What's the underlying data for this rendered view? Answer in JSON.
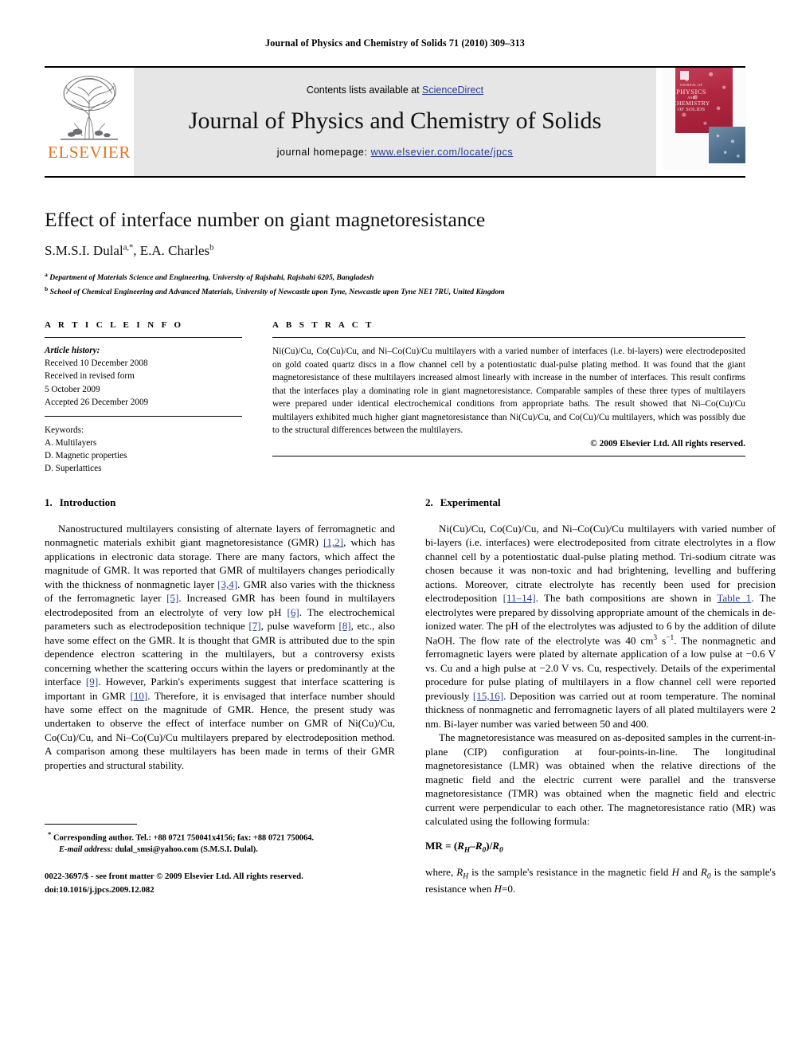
{
  "running_head": "Journal of Physics and Chemistry of Solids 71 (2010) 309–313",
  "masthead": {
    "publisher_name": "ELSEVIER",
    "contents_prefix": "Contents lists available at ",
    "contents_link": "ScienceDirect",
    "journal_title": "Journal of Physics and Chemistry of Solids",
    "homepage_prefix": "journal homepage: ",
    "homepage_url": "www.elsevier.com/locate/jpcs",
    "cover": {
      "line1": "JOURNAL OF",
      "line2": "PHYSICS",
      "line3": "AND",
      "line4": "CHEMISTRY",
      "line5": "OF SOLIDS"
    }
  },
  "article": {
    "title": "Effect of interface number on giant magnetoresistance",
    "authors": "S.M.S.I. Dulal",
    "author1_sup": "a,*",
    "author2": "E.A. Charles",
    "author2_sup": "b",
    "affiliation_a_marker": "a",
    "affiliation_a": "Department of Materials Science and Engineering, University of Rajshahi, Rajshahi 6205, Bangladesh",
    "affiliation_b_marker": "b",
    "affiliation_b": "School of Chemical Engineering and Advanced Materials, University of Newcastle upon Tyne, Newcastle upon Tyne NE1 7RU, United Kingdom"
  },
  "article_info": {
    "heading": "A R T I C L E   I N F O",
    "history_label": "Article history:",
    "history": [
      "Received 10 December 2008",
      "Received in revised form",
      "5 October 2009",
      "Accepted 26 December 2009"
    ],
    "keywords_label": "Keywords:",
    "keywords": [
      "A. Multilayers",
      "D. Magnetic properties",
      "D. Superlattices"
    ]
  },
  "abstract": {
    "heading": "A B S T R A C T",
    "text": "Ni(Cu)/Cu, Co(Cu)/Cu, and Ni–Co(Cu)/Cu multilayers with a varied number of interfaces (i.e. bi-layers) were electrodeposited on gold coated quartz discs in a flow channel cell by a potentiostatic dual-pulse plating method. It was found that the giant magnetoresistance of these multilayers increased almost linearly with increase in the number of interfaces. This result confirms that the interfaces play a dominating role in giant magnetoresistance. Comparable samples of these three types of multilayers were prepared under identical electrochemical conditions from appropriate baths. The result showed that Ni–Co(Cu)/Cu multilayers exhibited much higher giant magnetoresistance than Ni(Cu)/Cu, and Co(Cu)/Cu multilayers, which was possibly due to the structural differences between the multilayers.",
    "copyright": "© 2009 Elsevier Ltd. All rights reserved."
  },
  "sections": {
    "intro": {
      "number": "1.",
      "title": "Introduction",
      "p1_a": "Nanostructured multilayers consisting of alternate layers of ferromagnetic and nonmagnetic materials exhibit giant magnetoresistance (GMR) ",
      "p1_ref1": "[1,2]",
      "p1_b": ", which has applications in electronic data storage. There are many factors, which affect the magnitude of GMR. It was reported that GMR of multilayers changes periodically with the thickness of nonmagnetic layer ",
      "p1_ref2": "[3,4]",
      "p1_c": ". GMR also varies with the thickness of the ferromagnetic layer ",
      "p1_ref3": "[5]",
      "p1_d": ". Increased GMR has been found in multilayers electrodeposited from an electrolyte of very low pH ",
      "p1_ref4": "[6]",
      "p1_e": ". The electrochemical parameters such as electrodeposition technique ",
      "p1_ref5": "[7]",
      "p1_f": ", pulse waveform ",
      "p1_ref6": "[8]",
      "p1_g": ", etc., also have some effect on the GMR. It is thought that GMR is attributed due to the spin dependence electron scattering in the multilayers, but a controversy exists concerning whether the scattering occurs within the layers or predominantly at the interface ",
      "p1_ref7": "[9]",
      "p1_h": ". However, Parkin's experiments suggest that interface scattering is important in GMR ",
      "p1_ref8": "[10]",
      "p1_i": ". Therefore, it is envisaged that interface number should have some effect on the magnitude of GMR. Hence, the present study was undertaken to observe the effect of interface number on GMR of Ni(Cu)/Cu, Co(Cu)/Cu, and Ni–Co(Cu)/Cu multilayers prepared by electrodeposition method. A comparison among these multilayers has been made in terms of their GMR properties and structural stability."
    },
    "experimental": {
      "number": "2.",
      "title": "Experimental",
      "p1_a": "Ni(Cu)/Cu, Co(Cu)/Cu, and Ni–Co(Cu)/Cu multilayers with varied number of bi-layers (i.e. interfaces) were electrodeposited from citrate electrolytes in a flow channel cell by a potentiostatic dual-pulse plating method. Tri-sodium citrate was chosen because it was non-toxic and had brightening, levelling and buffering actions. Moreover, citrate electrolyte has recently been used for precision electrodeposition ",
      "p1_ref1": "[11–14]",
      "p1_b": ". The bath compositions are shown in ",
      "p1_ref2": "Table 1",
      "p1_c": ". The electrolytes were prepared by dissolving appropriate amount of the chemicals in de-ionized water. The pH of the electrolytes was adjusted to 6 by the addition of dilute NaOH. The flow rate of the electrolyte was 40 cm",
      "p1_sup1": "3",
      "p1_d": " s",
      "p1_sup2": "−1",
      "p1_e": ". The nonmagnetic and ferromagnetic layers were plated by alternate application of a low pulse at −0.6 V vs. Cu and a high pulse at −2.0 V vs. Cu, respectively. Details of the experimental procedure for pulse plating of multilayers in a flow channel cell were reported previously ",
      "p1_ref3": "[15,16]",
      "p1_f": ". Deposition was carried out at room temperature. The nominal thickness of nonmagnetic and ferromagnetic layers of all plated multilayers were 2 nm. Bi-layer number was varied between 50 and 400.",
      "p2": "The magnetoresistance was measured on as-deposited samples in the current-in-plane (CIP) configuration at four-points-in-line. The longitudinal magnetoresistance (LMR) was obtained when the relative directions of the magnetic field and the electric current were parallel and the transverse magnetoresistance (TMR) was obtained when the magnetic field and electric current were perpendicular to each other. The magnetoresistance ratio (MR) was calculated using the following formula:",
      "formula_lhs": "MR = (",
      "formula_rh": "R",
      "formula_rh_sub": "H",
      "formula_minus": "–",
      "formula_r0": "R",
      "formula_r0_sub": "0",
      "formula_mid": ")/",
      "formula_den": "R",
      "formula_den_sub": "0",
      "p3_a": "where, ",
      "p3_rh": "R",
      "p3_rh_sub": "H",
      "p3_b": " is the sample's resistance in the magnetic field ",
      "p3_h": "H",
      "p3_c": " and ",
      "p3_r0": "R",
      "p3_r0_sub": "0",
      "p3_d": " is the sample's resistance when ",
      "p3_h2": "H",
      "p3_e": "=0."
    }
  },
  "footnote": {
    "marker": "*",
    "line1": "Corresponding author. Tel.: +88 0721 750041x4156; fax: +88 0721 750064.",
    "email_label": "E-mail address:",
    "email": "dulal_smsi@yahoo.com (S.M.S.I. Dulal)."
  },
  "footer": {
    "issn_line": "0022-3697/$ - see front matter © 2009 Elsevier Ltd. All rights reserved.",
    "doi_line": "doi:10.1016/j.jpcs.2009.12.082"
  },
  "colors": {
    "link": "#2b3c8f",
    "elsevier_orange": "#E37222",
    "masthead_bg": "#e6e6e6"
  }
}
